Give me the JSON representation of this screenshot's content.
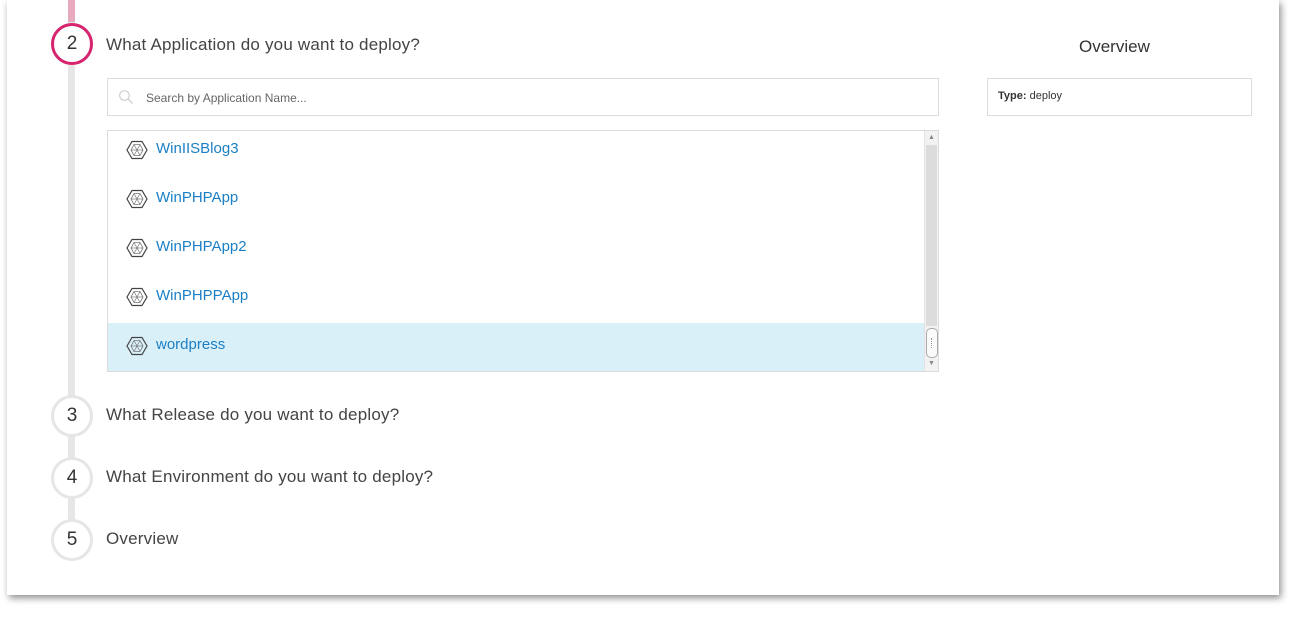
{
  "steps": [
    {
      "number": "2",
      "title": "What Application do you want to deploy?",
      "active": true
    },
    {
      "number": "3",
      "title": "What Release do you want to deploy?",
      "active": false
    },
    {
      "number": "4",
      "title": "What Environment do you want to deploy?",
      "active": false
    },
    {
      "number": "5",
      "title": "Overview",
      "active": false
    }
  ],
  "search": {
    "placeholder": "Search by Application Name...",
    "value": ""
  },
  "applications": [
    {
      "name": "WinIISBlog3",
      "icon": "application-hexagon-icon",
      "selected": false
    },
    {
      "name": "WinPHPApp",
      "icon": "application-hexagon-icon",
      "selected": false
    },
    {
      "name": "WinPHPApp2",
      "icon": "application-hexagon-icon",
      "selected": false
    },
    {
      "name": "WinPHPPApp",
      "icon": "application-hexagon-icon",
      "selected": false
    },
    {
      "name": "wordpress",
      "icon": "application-hexagon-icon",
      "selected": true
    }
  ],
  "overview": {
    "title": "Overview",
    "type_label": "Type:",
    "type_value": "deploy"
  },
  "colors": {
    "active_step": "#d6246e",
    "link": "#1b7fc5",
    "selected_row": "#d9f0f9"
  }
}
